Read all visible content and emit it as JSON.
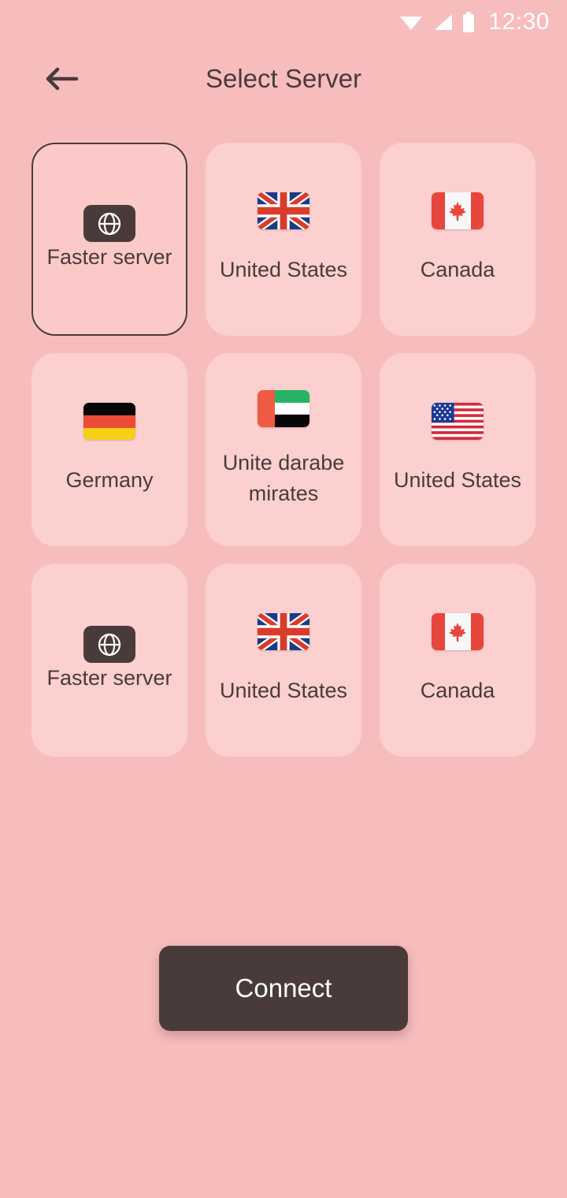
{
  "status_bar": {
    "time": "12:30",
    "icons": [
      "wifi-icon",
      "cellular-signal-icon",
      "battery-icon"
    ]
  },
  "app_bar": {
    "back_icon": "back-arrow-icon",
    "title": "Select Server"
  },
  "servers": [
    {
      "label": "Faster server",
      "flag": "globe",
      "selected": true,
      "wrapped": false
    },
    {
      "label": "United States",
      "flag": "uk",
      "selected": false,
      "wrapped": false
    },
    {
      "label": "Canada",
      "flag": "canada",
      "selected": false,
      "wrapped": false
    },
    {
      "label": "Germany",
      "flag": "germany",
      "selected": false,
      "wrapped": false
    },
    {
      "label": "Unite darabe mirates",
      "flag": "uae",
      "selected": false,
      "wrapped": true
    },
    {
      "label": "United States",
      "flag": "usa",
      "selected": false,
      "wrapped": false
    },
    {
      "label": "Faster server",
      "flag": "globe",
      "selected": false,
      "wrapped": false
    },
    {
      "label": "United States",
      "flag": "uk",
      "selected": false,
      "wrapped": false
    },
    {
      "label": "Canada",
      "flag": "canada",
      "selected": false,
      "wrapped": false
    }
  ],
  "footer": {
    "connect_label": "Connect"
  },
  "colors": {
    "background": "#f7bdbd",
    "card": "#fbd0ce",
    "accent_dark": "#4a3b3b",
    "text_on_dark": "#ffffff"
  }
}
